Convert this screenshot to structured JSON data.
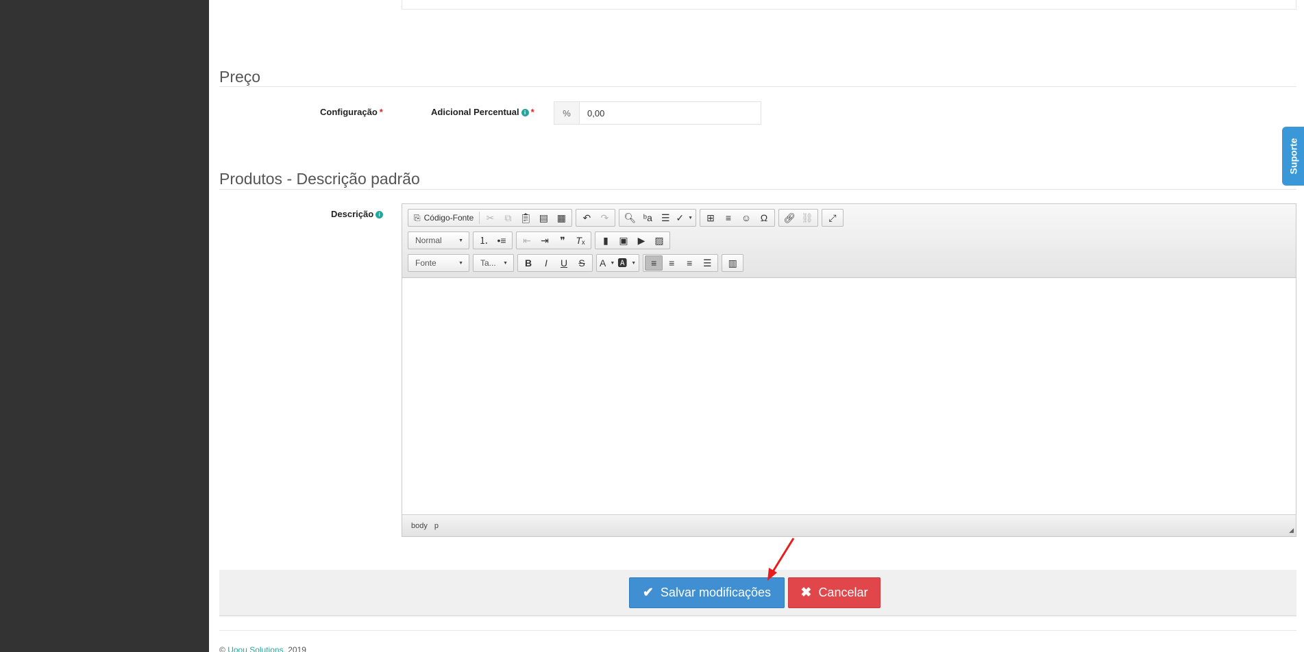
{
  "sections": {
    "preco_title": "Preço",
    "produtos_title": "Produtos - Descrição padrão"
  },
  "preco": {
    "configuracao_label": "Configuração",
    "adicional_label": "Adicional Percentual",
    "required_mark": "*",
    "percent_addon": "%",
    "percent_value": "0,00"
  },
  "descricao": {
    "label": "Descrição"
  },
  "editor": {
    "source_label": "Código-Fonte",
    "format_combo": "Normal",
    "font_combo": "Fonte",
    "size_combo": "Ta...",
    "path_body": "body",
    "path_p": "p"
  },
  "actions": {
    "save_label": "Salvar modificações",
    "cancel_label": "Cancelar"
  },
  "footer": {
    "copyright": "©",
    "company": "Uoou Solutions",
    "year": ", 2019"
  },
  "support_tab": "Suporte",
  "colors": {
    "sidebar": "#333333",
    "save_button": "#3f8fd2",
    "cancel_button": "#e0464a",
    "accent": "#26a69a",
    "annotation_arrow": "#e81c1c"
  }
}
